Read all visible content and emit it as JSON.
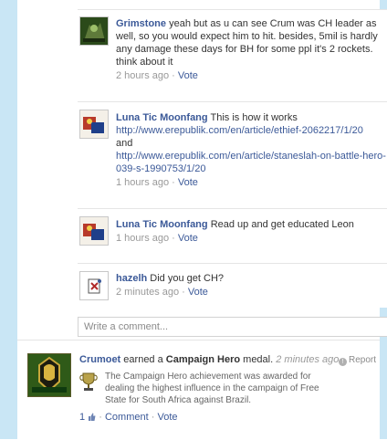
{
  "comments": [
    {
      "author": "Grimstone",
      "text": "yeah but as u can see Crum was CH leader as well, so you would expect him to hit. besides, 5mil is hardly any damage these days for BH for some ppl it's 2 rockets. think about it",
      "time": "2 hours ago",
      "vote": "Vote"
    },
    {
      "author": "Luna Tic Moonfang",
      "text": "This is how it works",
      "link1": "http://www.erepublik.com/en/article/ethief-2062217/1/20",
      "and": "and",
      "link2": "http://www.erepublik.com/en/article/staneslah-on-battle-hero-039-s-1990753/1/20",
      "time": "1 hours ago",
      "vote": "Vote"
    },
    {
      "author": "Luna Tic Moonfang",
      "text": "Read up and get educated Leon",
      "time": "1 hours ago",
      "vote": "Vote"
    },
    {
      "author": "hazelh",
      "text": "Did you get CH?",
      "time": "2 minutes ago",
      "vote": "Vote"
    }
  ],
  "comment_box": {
    "placeholder": "Write a comment..."
  },
  "story": {
    "author": "Crumoet",
    "action": "earned a",
    "medal": "Campaign Hero",
    "medal_suffix": "medal.",
    "time": "2 minutes ago",
    "report": "Report",
    "description": "The Campaign Hero achievement was awarded for dealing the highest influence in the campaign of Free State for South Africa against Brazil.",
    "likes": "1",
    "comment_label": "Comment",
    "vote_label": "Vote"
  },
  "separator": "·",
  "colors": {
    "side_rail": "#c9e6f5",
    "link": "#3b5998",
    "meta": "#999999"
  }
}
